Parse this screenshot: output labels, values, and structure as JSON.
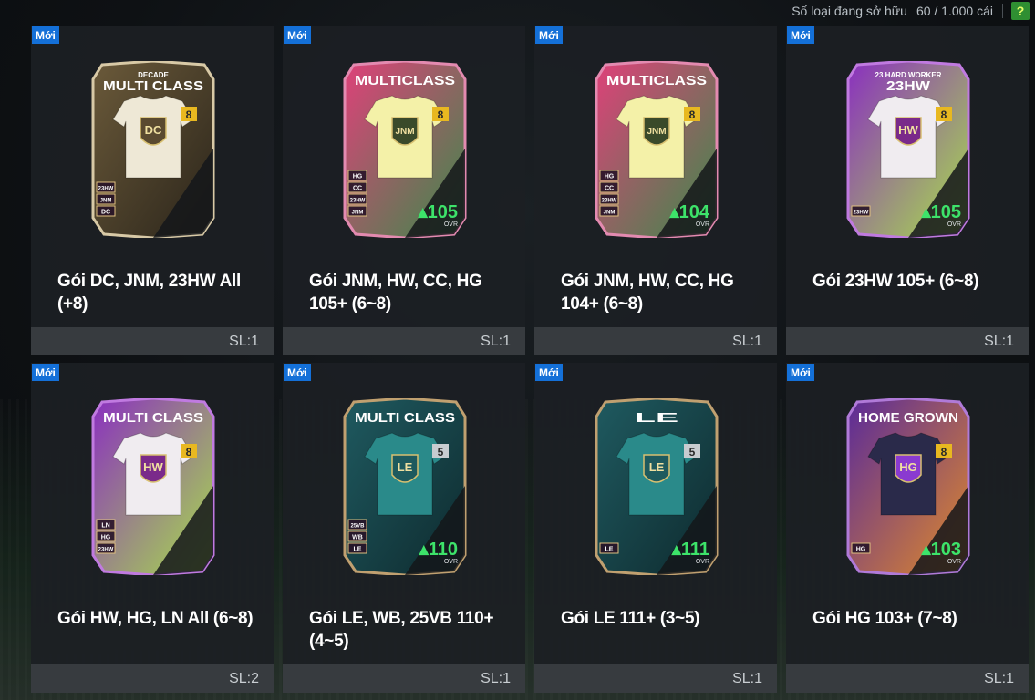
{
  "header": {
    "owned_label": "Số loại đang sở hữu",
    "owned_value": "60 / 1.000 cái",
    "help_label": "?"
  },
  "packs": [
    {
      "badge": "Mới",
      "title": "Gói DC, JNM, 23HW All (+8)",
      "qty": "SL:1",
      "card": {
        "name_small": "DECADE",
        "name": "MULTI CLASS",
        "level": "8",
        "crest": "DC",
        "ovr": "",
        "ovr_label": "",
        "chips": [
          "23HW",
          "JNM",
          "DC"
        ],
        "theme": "gold"
      }
    },
    {
      "badge": "Mới",
      "title": "Gói JNM, HW, CC, HG 105+ (6~8)",
      "qty": "SL:1",
      "card": {
        "name_small": "",
        "name": "MULTICLASS",
        "level": "8",
        "crest": "JNM",
        "ovr": "105",
        "ovr_label": "OVR",
        "chips": [
          "HG",
          "CC",
          "23HW",
          "JNM"
        ],
        "theme": "pink"
      }
    },
    {
      "badge": "Mới",
      "title": "Gói JNM, HW, CC, HG 104+ (6~8)",
      "qty": "SL:1",
      "card": {
        "name_small": "",
        "name": "MULTICLASS",
        "level": "8",
        "crest": "JNM",
        "ovr": "104",
        "ovr_label": "OVR",
        "chips": [
          "HG",
          "CC",
          "23HW",
          "JNM"
        ],
        "theme": "pink"
      }
    },
    {
      "badge": "Mới",
      "title": "Gói 23HW 105+ (6~8)",
      "qty": "SL:1",
      "card": {
        "name_small": "23 HARD WORKER",
        "name": "23HW",
        "level": "8",
        "crest": "HW",
        "ovr": "105",
        "ovr_label": "OVR",
        "chips": [
          "23HW"
        ],
        "theme": "green"
      }
    },
    {
      "badge": "Mới",
      "title": "Gói HW, HG, LN All (6~8)",
      "qty": "SL:2",
      "card": {
        "name_small": "",
        "name": "MULTI CLASS",
        "level": "8",
        "crest": "HW",
        "ovr": "",
        "ovr_label": "",
        "chips": [
          "LN",
          "HG",
          "23HW"
        ],
        "theme": "green"
      }
    },
    {
      "badge": "Mới",
      "title": "Gói LE, WB, 25VB 110+ (4~5)",
      "qty": "SL:1",
      "card": {
        "name_small": "",
        "name": "MULTI CLASS",
        "level": "5",
        "crest": "LE",
        "ovr": "110",
        "ovr_label": "OVR",
        "chips": [
          "25VB",
          "WB",
          "LE"
        ],
        "theme": "teal"
      }
    },
    {
      "badge": "Mới",
      "title": "Gói LE 111+ (3~5)",
      "qty": "SL:1",
      "card": {
        "name_small": "",
        "name": "LE",
        "level": "5",
        "crest": "LE",
        "ovr": "111",
        "ovr_label": "OVR",
        "chips": [
          "LE"
        ],
        "theme": "teal"
      }
    },
    {
      "badge": "Mới",
      "title": "Gói HG 103+ (7~8)",
      "qty": "SL:1",
      "card": {
        "name_small": "",
        "name": "HOME GROWN",
        "level": "8",
        "crest": "HG",
        "ovr": "103",
        "ovr_label": "OVR",
        "chips": [
          "HG"
        ],
        "theme": "purple"
      }
    }
  ],
  "colors": {
    "badge": "#1470d8",
    "ovr_green": "#3de36a",
    "help_bg": "#2f8f32",
    "help_fg": "#e6ff6a"
  }
}
